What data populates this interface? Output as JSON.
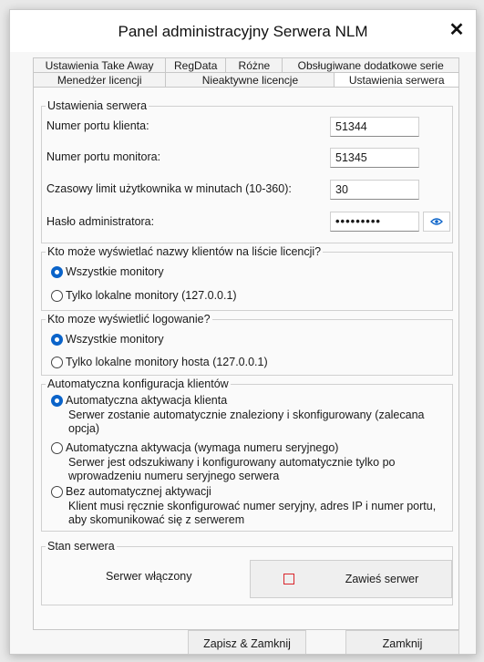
{
  "window": {
    "title": "Panel administracyjny Serwera NLM",
    "close_glyph": "✕"
  },
  "tabs_top": [
    "Ustawienia Take Away",
    "RegData",
    "Różne",
    "Obsługiwane dodatkowe serie"
  ],
  "tabs_bottom": [
    "Menedżer licencji",
    "Nieaktywne licencje",
    "Ustawienia serwera"
  ],
  "active_tab": "Ustawienia serwera",
  "server_settings": {
    "title": "Ustawienia serwera",
    "client_port": {
      "label": "Numer portu klienta:",
      "value": "51344"
    },
    "monitor_port": {
      "label": "Numer portu monitora:",
      "value": "51345"
    },
    "timeout": {
      "label": "Czasowy limit użytkownika w minutach (10-360):",
      "value": "30"
    },
    "admin_password": {
      "label": "Hasło administratora:",
      "value": "•••••••••",
      "icon": "eye-icon"
    }
  },
  "client_names": {
    "title": "Kto może wyświetlać nazwy klientów na liście licencji?",
    "options": [
      "Wszystkie monitory",
      "Tylko lokalne monitory (127.0.0.1)"
    ],
    "selected": 0
  },
  "logging": {
    "title": "Kto moze wyświetlić logowanie?",
    "options": [
      "Wszystkie monitory",
      "Tylko lokalne monitory hosta (127.0.0.1)"
    ],
    "selected": 0
  },
  "auto_config": {
    "title": "Automatyczna konfiguracja klientów",
    "options": [
      {
        "label": "Automatyczna aktywacja klienta",
        "desc1": "Serwer zostanie automatycznie znaleziony i skonfigurowany (zalecana",
        "desc2": "opcja)"
      },
      {
        "label": "Automatyczna aktywacja (wymaga numeru seryjnego)",
        "desc1": "Serwer jest odszukiwany i konfigurowany automatycznie tylko po",
        "desc2": "wprowadzeniu numeru seryjnego serwera"
      },
      {
        "label": "Bez automatycznej aktywacji",
        "desc1": "Klient musi ręcznie skonfigurować numer seryjny, adres IP i numer portu,",
        "desc2": "aby skomunikować się z serwerem"
      }
    ],
    "selected": 0
  },
  "server_state": {
    "title": "Stan serwera",
    "status": "Serwer włączony",
    "suspend_button": "Zawieś serwer"
  },
  "footer": {
    "save_close": "Zapisz & Zamknij",
    "close": "Zamknij"
  },
  "colors": {
    "accent": "#0a63c9",
    "stop_icon": "#d9252b"
  }
}
